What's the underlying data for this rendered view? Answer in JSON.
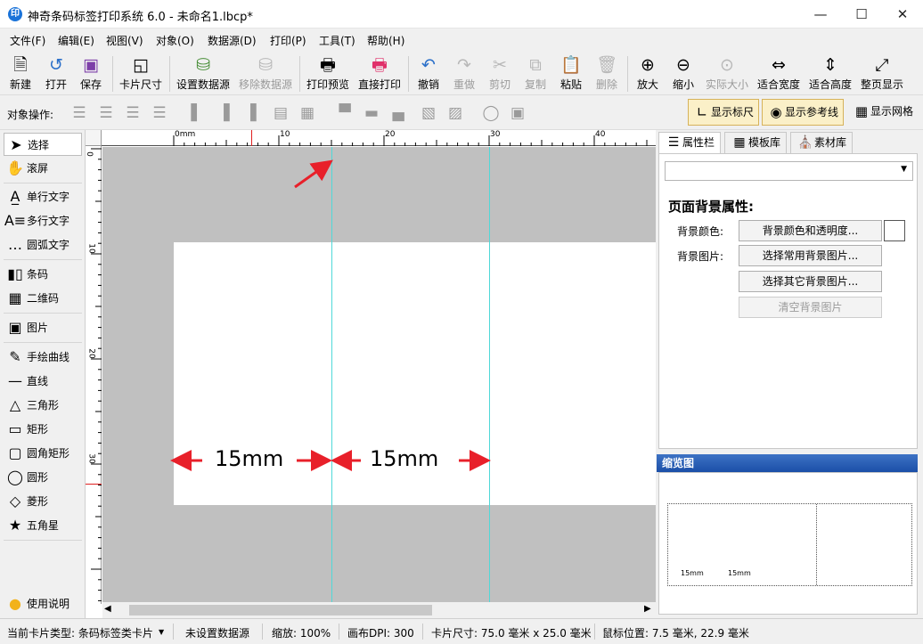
{
  "window": {
    "title": "神奇条码标签打印系统 6.0 - 未命名1.lbcp*",
    "logo_text": "印"
  },
  "menu": [
    "文件(F)",
    "编辑(E)",
    "视图(V)",
    "对象(O)",
    "数据源(D)",
    "打印(P)",
    "工具(T)",
    "帮助(H)"
  ],
  "toolbar": {
    "new": "新建",
    "open": "打开",
    "save": "保存",
    "card_size": "卡片尺寸",
    "set_ds": "设置数据源",
    "remove_ds": "移除数据源",
    "print_preview": "打印预览",
    "direct_print": "直接打印",
    "undo": "撤销",
    "redo": "重做",
    "cut": "剪切",
    "copy": "复制",
    "paste": "粘贴",
    "delete": "删除",
    "zoom_in": "放大",
    "zoom_out": "缩小",
    "actual_size": "实际大小",
    "fit_width": "适合宽度",
    "fit_height": "适合高度",
    "whole_page": "整页显示"
  },
  "objbar": {
    "label": "对象操作:",
    "show_ruler": "显示标尺",
    "show_guides": "显示参考线",
    "show_grid": "显示网格"
  },
  "tools": {
    "select": "选择",
    "scroll": "滚屏",
    "single_text": "单行文字",
    "multi_text": "多行文字",
    "arc_text": "圆弧文字",
    "barcode": "条码",
    "qrcode": "二维码",
    "image": "图片",
    "freehand": "手绘曲线",
    "line": "直线",
    "triangle": "三角形",
    "rect": "矩形",
    "round_rect": "圆角矩形",
    "ellipse": "圆形",
    "diamond": "菱形",
    "star": "五角星",
    "help": "使用说明"
  },
  "ruler": {
    "h_ticks": [
      "0mm",
      "10",
      "20",
      "30",
      "40"
    ],
    "v_ticks": [
      "0",
      "10",
      "20",
      "30"
    ]
  },
  "canvas": {
    "dim1": "15mm",
    "dim2": "15mm"
  },
  "panel": {
    "tab_props": "属性栏",
    "tab_templates": "模板库",
    "tab_assets": "素材库",
    "section_title": "页面背景属性:",
    "bg_color_label": "背景颜色:",
    "bg_color_btn": "背景颜色和透明度...",
    "bg_image_label": "背景图片:",
    "bg_common_btn": "选择常用背景图片...",
    "bg_other_btn": "选择其它背景图片...",
    "bg_clear_btn": "清空背景图片",
    "preview_title": "缩览图",
    "preview_text1": "15mm",
    "preview_text2": "15mm"
  },
  "status": {
    "card_type": "当前卡片类型: 条码标签类卡片",
    "ds": "未设置数据源",
    "zoom": "缩放: 100%",
    "dpi": "画布DPI: 300",
    "size": "卡片尺寸: 75.0 毫米 x 25.0 毫米",
    "mouse": "鼠标位置: 7.5 毫米, 22.9 毫米"
  }
}
